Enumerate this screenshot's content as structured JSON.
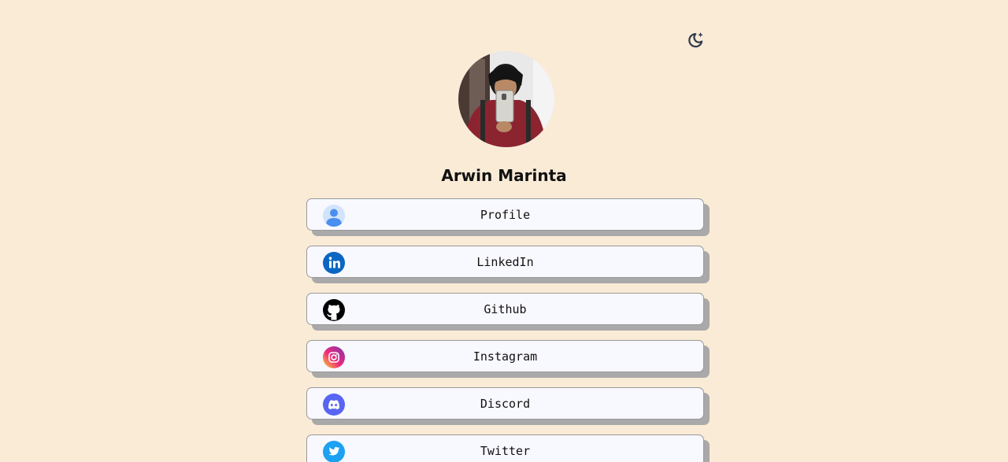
{
  "profile": {
    "name": "Arwin Marinta"
  },
  "theme_toggle": {
    "icon": "moon-sparkle-icon"
  },
  "colors": {
    "background": "#faebd7",
    "card_background": "#f8f8ff",
    "card_shadow": "#a9a9a9"
  },
  "links": [
    {
      "label": "Profile",
      "icon": "user-icon"
    },
    {
      "label": "LinkedIn",
      "icon": "linkedin-icon"
    },
    {
      "label": "Github",
      "icon": "github-icon"
    },
    {
      "label": "Instagram",
      "icon": "instagram-icon"
    },
    {
      "label": "Discord",
      "icon": "discord-icon"
    },
    {
      "label": "Twitter",
      "icon": "twitter-icon"
    }
  ]
}
